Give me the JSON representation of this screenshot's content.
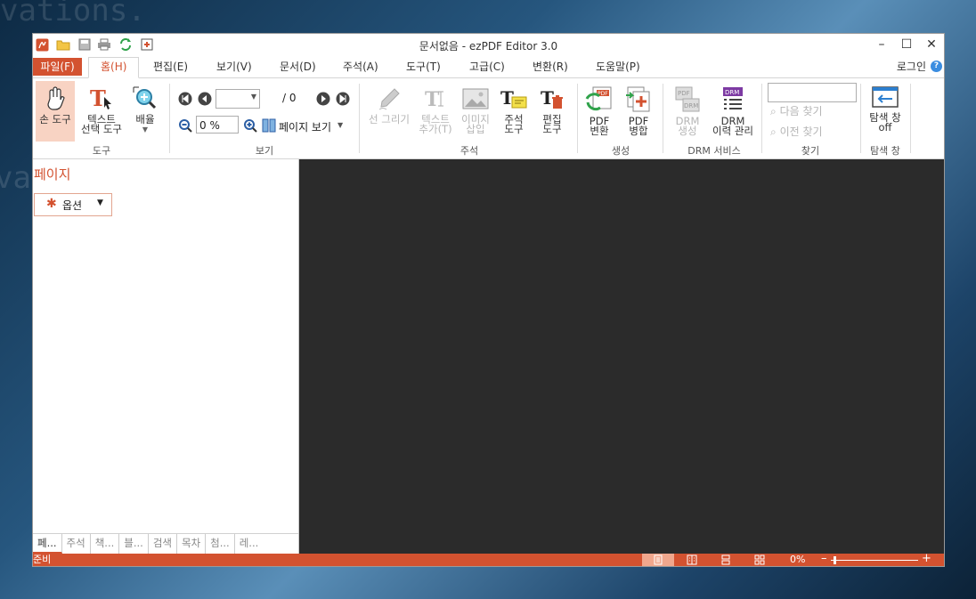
{
  "window": {
    "title": "문서없음 - ezPDF Editor 3.0"
  },
  "menu": {
    "file": "파일(F)",
    "items": [
      "홈(H)",
      "편집(E)",
      "보기(V)",
      "문서(D)",
      "주석(A)",
      "도구(T)",
      "고급(C)",
      "변환(R)",
      "도움말(P)"
    ],
    "login": "로그인"
  },
  "ribbon": {
    "tools": {
      "hand": "손 도구",
      "text_select_1": "텍스트",
      "text_select_2": "선택 도구",
      "zoom": "배율",
      "group": "도구"
    },
    "view": {
      "page_of": "/ 0",
      "zoom_value": "0 %",
      "page_view": "페이지 보기",
      "group": "보기"
    },
    "annot": {
      "draw": "선 그리기",
      "text_add_1": "텍스트",
      "text_add_2": "추가(T)",
      "image_1": "이미지",
      "image_2": "삽입",
      "annot_tool_1": "주석",
      "annot_tool_2": "도구",
      "edit_tool_1": "편집",
      "edit_tool_2": "도구",
      "group": "주석"
    },
    "create": {
      "pdf_convert_1": "PDF",
      "pdf_convert_2": "변환",
      "pdf_merge_1": "PDF",
      "pdf_merge_2": "병합",
      "group": "생성"
    },
    "drm": {
      "drm_create_1": "DRM",
      "drm_create_2": "생성",
      "drm_history_1": "DRM",
      "drm_history_2": "이력 관리",
      "group": "DRM 서비스",
      "icon_text": "DRM",
      "pdf_text": "PDF"
    },
    "find": {
      "next": "다음 찾기",
      "prev": "이전 찾기",
      "group": "찾기"
    },
    "nav": {
      "label_1": "탐색 창",
      "label_2": "off",
      "group": "탐색 창"
    }
  },
  "panel": {
    "title": "페이지",
    "options": "옵션",
    "tabs": [
      "페...",
      "주석",
      "책...",
      "블...",
      "검색",
      "목차",
      "첨...",
      "레..."
    ]
  },
  "status": {
    "text": "준비",
    "zoom": "0%"
  },
  "colors": {
    "accent": "#d35230",
    "doc_bg": "#2b2b2b"
  }
}
